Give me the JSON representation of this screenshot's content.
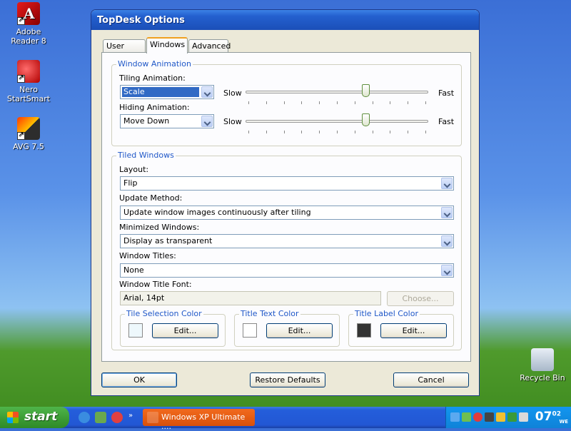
{
  "desktop": {
    "icons": [
      {
        "label": "Adobe Reader 8"
      },
      {
        "label": "Nero StartSmart"
      },
      {
        "label": "AVG 7.5"
      },
      {
        "label": "Recycle Bin"
      }
    ]
  },
  "window": {
    "title": "TopDesk Options",
    "tabs": [
      {
        "label": "User Input"
      },
      {
        "label": "Windows"
      },
      {
        "label": "Advanced"
      }
    ],
    "window_animation": {
      "title": "Window Animation",
      "tiling_label": "Tiling Animation:",
      "tiling_value": "Scale",
      "hiding_label": "Hiding Animation:",
      "hiding_value": "Move Down",
      "slow_label": "Slow",
      "fast_label": "Fast",
      "tiling_speed": 0.66,
      "hiding_speed": 0.66
    },
    "tiled_windows": {
      "title": "Tiled Windows",
      "layout_label": "Layout:",
      "layout_value": "Flip",
      "update_label": "Update Method:",
      "update_value": "Update window images continuously after tiling",
      "minimized_label": "Minimized Windows:",
      "minimized_value": "Display as transparent",
      "titles_label": "Window Titles:",
      "titles_value": "None",
      "font_label": "Window Title Font:",
      "font_value": "Arial, 14pt",
      "choose_button": "Choose...",
      "color_groups": [
        {
          "title": "Tile Selection Color",
          "button": "Edit...",
          "color": "#eef8fc"
        },
        {
          "title": "Title Text Color",
          "button": "Edit...",
          "color": "#ffffff"
        },
        {
          "title": "Title Label Color",
          "button": "Edit...",
          "color": "#333333"
        }
      ]
    },
    "buttons": {
      "ok": "OK",
      "restore": "Restore Defaults",
      "cancel": "Cancel"
    }
  },
  "taskbar": {
    "start_label": "start",
    "task_label": "Windows XP Ultimate ....",
    "clock": {
      "hour": "07",
      "minute": "02",
      "day": "WE"
    }
  },
  "colors": {
    "accent": "#316ac5",
    "group_title": "#2058c8",
    "titlebar": "#2460cf",
    "start_green": "#3a9a33"
  }
}
